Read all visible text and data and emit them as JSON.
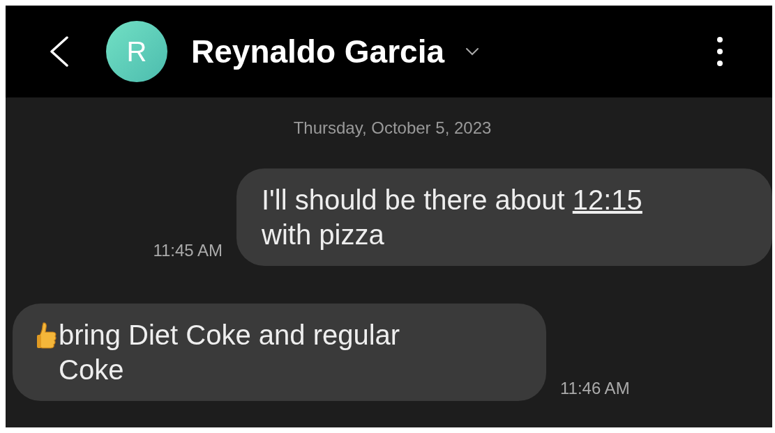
{
  "header": {
    "avatar_letter": "R",
    "contact_name": "Reynaldo Garcia"
  },
  "date_divider": "Thursday, October 5, 2023",
  "messages": [
    {
      "kind": "outgoing",
      "thumbs_up": false,
      "text_before": "I'll should be there about ",
      "link": "12:15",
      "text_after": " with pizza",
      "time": "11:45 AM"
    },
    {
      "kind": "incoming",
      "thumbs_up": true,
      "text_before": "bring Diet Coke and regular Coke",
      "time": "11:46 AM"
    }
  ]
}
